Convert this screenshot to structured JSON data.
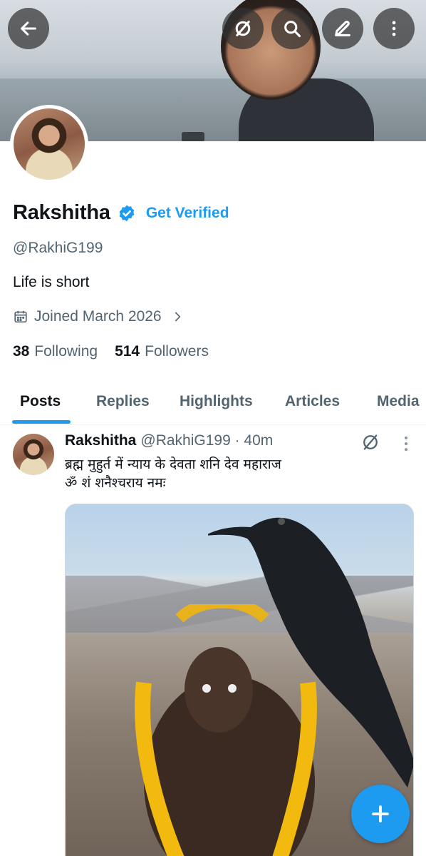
{
  "profile": {
    "name": "Rakshitha",
    "get_verified": "Get Verified",
    "handle": "@RakhiG199",
    "bio": "Life is short",
    "joined": "Joined March 2026",
    "following_count": "38",
    "following_label": "Following",
    "followers_count": "514",
    "followers_label": "Followers"
  },
  "tabs": [
    {
      "label": "Posts",
      "active": true
    },
    {
      "label": "Replies",
      "active": false
    },
    {
      "label": "Highlights",
      "active": false
    },
    {
      "label": "Articles",
      "active": false
    },
    {
      "label": "Media",
      "active": false
    }
  ],
  "post": {
    "author_name": "Rakshitha",
    "author_handle": "@RakhiG199 · 40m",
    "text_line1": "ब्रह्म मुहुर्त में न्याय के देवता शनि देव महाराज",
    "text_line2": "ॐ शं शनैश्चराय नमः"
  },
  "icons": {
    "back": "arrow-left-icon",
    "grok": "grok-icon",
    "search": "search-icon",
    "edit": "edit-icon",
    "more": "more-vertical-icon",
    "verified": "verified-badge-icon",
    "calendar": "calendar-icon",
    "compose": "plus-icon"
  },
  "colors": {
    "accent": "#1d9bf0",
    "text_primary": "#0f1419",
    "text_secondary": "#536471"
  }
}
